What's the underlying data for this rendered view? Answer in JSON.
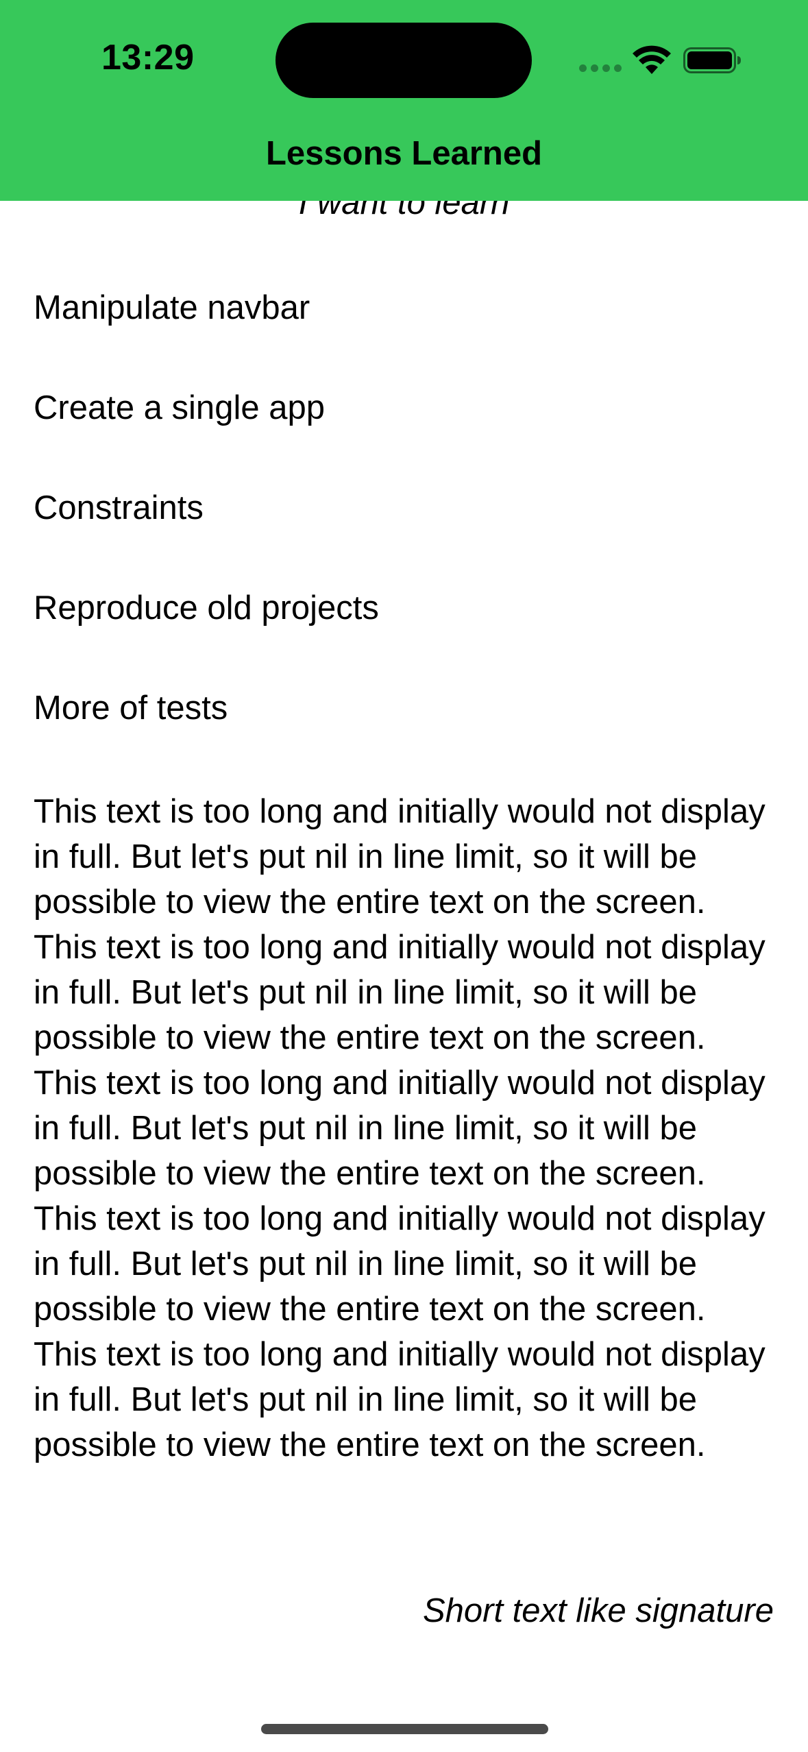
{
  "status_bar": {
    "time": "13:29",
    "icons": [
      "signal-dots-icon",
      "wifi-icon",
      "battery-icon"
    ]
  },
  "nav_bar": {
    "title": "Lessons Learned",
    "background_color": "#37c85a"
  },
  "content": {
    "section_header": "I want to learn",
    "items": [
      "Manipulate navbar",
      "Create a single app",
      "Constraints",
      "Reproduce old projects",
      "More of tests"
    ],
    "long_text": "This text is too long and initially would not display in full. But let's put nil in line limit, so it will be possible to view the entire text on the screen. This text is too long and initially would not display in full. But let's put nil in line limit, so it will be possible to view the entire text on the screen. This text is too long and initially would not display in full. But let's put nil in line limit, so it will be possible to view the entire text on the screen. This text is too long and initially would not display in full. But let's put nil in line limit, so it will be possible to view the entire text on the screen. This text is too long and initially would not display in full. But let's put nil in line limit, so it will be possible to view the entire text on the screen.",
    "signature": "Short text like signature"
  }
}
